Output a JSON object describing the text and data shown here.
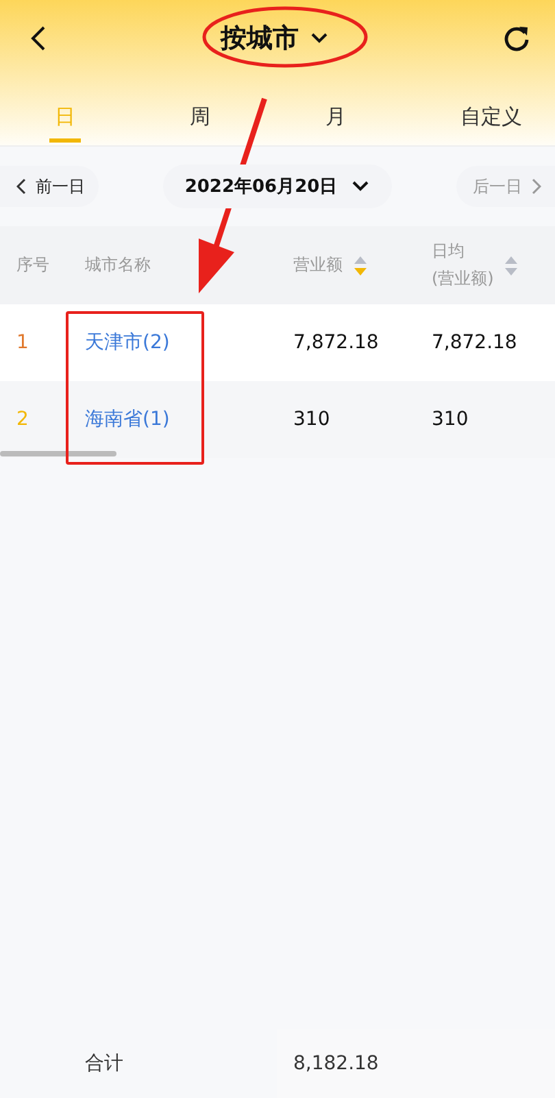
{
  "header": {
    "title": "按城市"
  },
  "tabs": [
    {
      "label": "日",
      "selected": true
    },
    {
      "label": "周",
      "selected": false
    },
    {
      "label": "月",
      "selected": false
    },
    {
      "label": "自定义",
      "selected": false
    }
  ],
  "date_bar": {
    "prev": "前一日",
    "date": "2022年06月20日",
    "next": "后一日"
  },
  "table": {
    "columns": [
      {
        "label": "序号"
      },
      {
        "label": "城市名称"
      },
      {
        "label": "营业额",
        "sort_desc": true
      },
      {
        "label": "日均",
        "sublabel": "(营业额)",
        "sort_desc": false
      }
    ],
    "rows": [
      {
        "rank": "1",
        "color": "#e0782c",
        "city": "天津市(2)",
        "amount": "7,872.18",
        "daily": "7,872.18"
      },
      {
        "rank": "2",
        "color": "#f2b705",
        "city": "海南省(1)",
        "amount": "310",
        "daily": "310"
      }
    ]
  },
  "footer": {
    "label": "合计",
    "total": "8,182.18"
  },
  "annotations": [
    {
      "kind": "ellipse"
    },
    {
      "kind": "arrow"
    },
    {
      "kind": "rectangle"
    }
  ]
}
